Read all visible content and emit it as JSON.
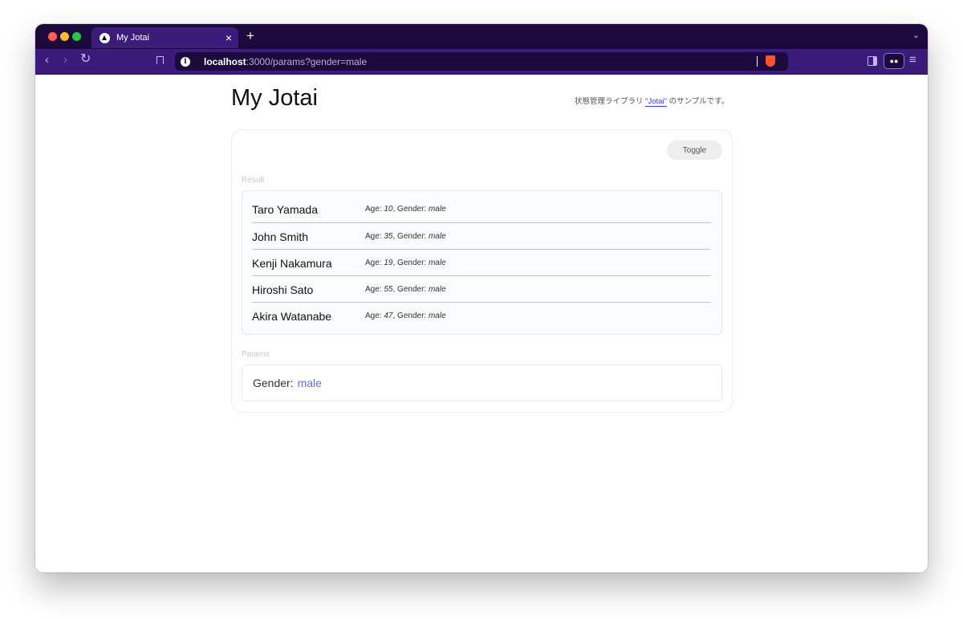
{
  "browser": {
    "tab_title": "My Jotai",
    "tab_close": "×",
    "new_tab": "+",
    "tab_menu": "⌄",
    "url_host": "localhost",
    "url_rest": ":3000/params?gender=male",
    "icons": [
      "back-icon",
      "forward-icon",
      "reload-icon",
      "bookmark-icon",
      "site-info-icon",
      "brave-shield-icon",
      "sidebar-icon",
      "private-glasses-icon",
      "menu-icon"
    ]
  },
  "page": {
    "title": "My Jotai",
    "subtitle_prefix": "状態管理ライブラリ ",
    "subtitle_link": "\"Jotai\"",
    "subtitle_suffix": " のサンプルです。"
  },
  "card": {
    "toggle_label": "Toggle",
    "result_label": "Result",
    "params_label": "Params",
    "age_label": "Age:",
    "gender_label": "Gender:",
    "results": [
      {
        "name": "Taro Yamada",
        "age": "10",
        "gender": "male"
      },
      {
        "name": "John Smith",
        "age": "35",
        "gender": "male"
      },
      {
        "name": "Kenji Nakamura",
        "age": "19",
        "gender": "male"
      },
      {
        "name": "Hiroshi Sato",
        "age": "55",
        "gender": "male"
      },
      {
        "name": "Akira Watanabe",
        "age": "47",
        "gender": "male"
      }
    ],
    "params": {
      "key": "Gender:",
      "value": "male"
    }
  },
  "colors": {
    "browser_dark": "#1c0a3c",
    "browser_toolbar": "#3b1c7a",
    "link": "#3b3bd6",
    "param_value": "#6a6ae8"
  }
}
